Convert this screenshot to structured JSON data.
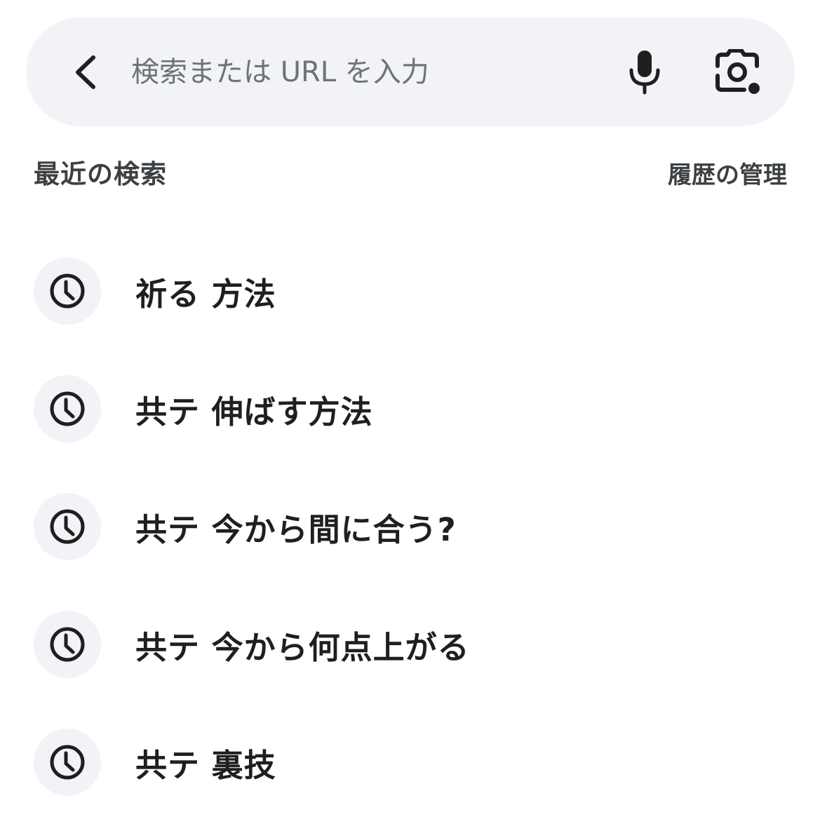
{
  "search": {
    "placeholder": "検索または URL を入力",
    "value": ""
  },
  "recent": {
    "title": "最近の検索",
    "manage_label": "履歴の管理"
  },
  "history": [
    {
      "text": "祈る 方法"
    },
    {
      "text": "共テ 伸ばす方法"
    },
    {
      "text": "共テ 今から間に合う?"
    },
    {
      "text": "共テ 今から何点上がる"
    },
    {
      "text": "共テ 裏技"
    }
  ],
  "icons": {
    "back": "back-arrow-icon",
    "mic": "microphone-icon",
    "lens": "google-lens-icon",
    "history": "clock-icon"
  },
  "colors": {
    "bar_background": "#f1f3f6",
    "icon": "#1f1f1f",
    "placeholder": "#6f7277",
    "secondary_text": "#3c4043"
  }
}
